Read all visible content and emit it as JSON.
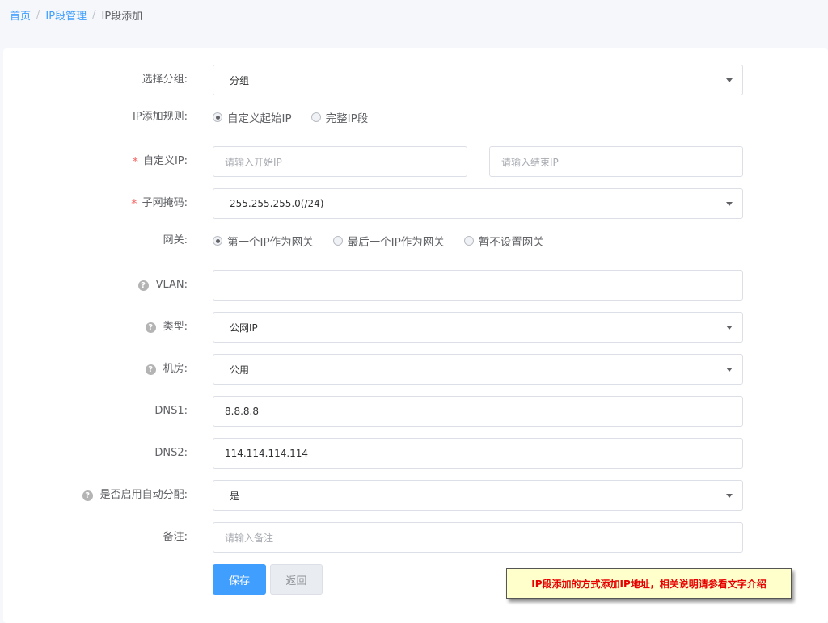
{
  "breadcrumb": {
    "home": "首页",
    "sep1": "/",
    "ip_manage": "IP段管理",
    "sep2": "/",
    "current": "IP段添加"
  },
  "form": {
    "group": {
      "label": "选择分组:",
      "value": "分组"
    },
    "rule": {
      "label": "IP添加规则:",
      "options": [
        "自定义起始IP",
        "完整IP段"
      ],
      "selected": "自定义起始IP"
    },
    "custom_ip": {
      "required_mark": "*",
      "label": "自定义IP:",
      "start_placeholder": "请输入开始IP",
      "end_placeholder": "请输入结束IP"
    },
    "subnet": {
      "required_mark": "*",
      "label": "子网掩码:",
      "value": "255.255.255.0(/24)"
    },
    "gateway": {
      "label": "网关:",
      "options": [
        "第一个IP作为网关",
        "最后一个IP作为网关",
        "暂不设置网关"
      ],
      "selected": "第一个IP作为网关"
    },
    "vlan": {
      "help": "?",
      "label": "VLAN:",
      "value": ""
    },
    "type": {
      "help": "?",
      "label": "类型:",
      "value": "公网IP"
    },
    "room": {
      "help": "?",
      "label": "机房:",
      "value": "公用"
    },
    "dns1": {
      "label": "DNS1:",
      "value": "8.8.8.8"
    },
    "dns2": {
      "label": "DNS2:",
      "value": "114.114.114.114"
    },
    "auto_assign": {
      "help": "?",
      "label": "是否启用自动分配:",
      "value": "是"
    },
    "remark": {
      "label": "备注:",
      "placeholder": "请输入备注"
    }
  },
  "buttons": {
    "save": "保存",
    "back": "返回"
  },
  "annotation": "IP段添加的方式添加IP地址，相关说明请参看文字介绍",
  "colors": {
    "primary": "#409eff",
    "required": "#f56c6c",
    "note_text": "#e60000",
    "note_bg": "#ffffcc"
  }
}
